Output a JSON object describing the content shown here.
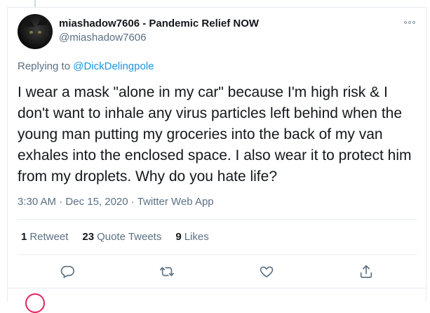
{
  "tweet": {
    "display_name": "miashadow7606 - Pandemic Relief NOW",
    "handle": "@miashadow7606",
    "reply_prefix": "Replying to",
    "reply_to": "@DickDelingpole",
    "text": "I wear a mask \"alone in my car\" because I'm high risk & I don't want to inhale any virus particles left behind when the young man putting my groceries into the back of my van exhales into the enclosed space. I also wear it to protect him from my droplets. Why do you hate life?",
    "time": "3:30 AM",
    "date": "Dec 15, 2020",
    "separator": "·",
    "source": "Twitter Web App"
  },
  "stats": {
    "retweets_count": "1",
    "retweets_label": "Retweet",
    "quotes_count": "23",
    "quotes_label": "Quote Tweets",
    "likes_count": "9",
    "likes_label": "Likes"
  },
  "icons": {
    "more": "more-horizontal-icon",
    "reply": "reply-bubble-icon",
    "retweet": "retweet-icon",
    "like": "heart-icon",
    "share": "share-icon"
  },
  "colors": {
    "accent": "#1b95e0",
    "muted": "#5b7083",
    "text": "#14171a",
    "icon": "#5b7083",
    "divider": "#e6ecf0"
  }
}
